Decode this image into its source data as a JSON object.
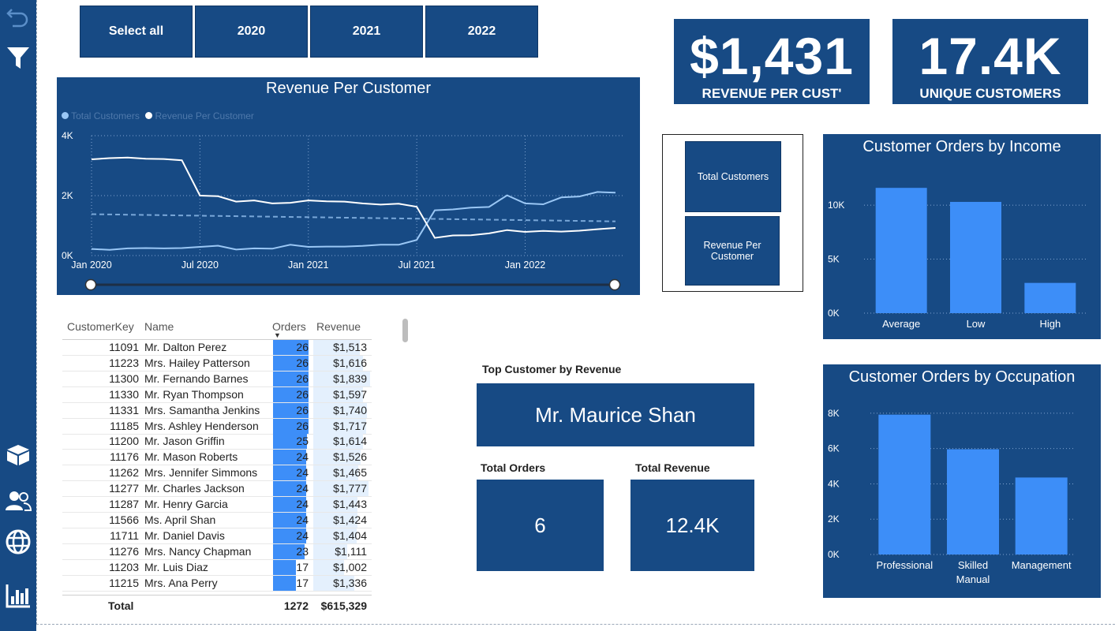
{
  "sidebar": {
    "icons": [
      "undo-icon",
      "filter-icon",
      "box-icon",
      "users-icon",
      "globe-icon",
      "bar-chart-icon"
    ]
  },
  "slicer": {
    "buttons": [
      "Select all",
      "2020",
      "2021",
      "2022"
    ]
  },
  "kpis": {
    "revenue_per_cust": {
      "value": "$1,431",
      "label": "REVENUE PER CUST'"
    },
    "unique_customers": {
      "value": "17.4K",
      "label": "UNIQUE CUSTOMERS"
    }
  },
  "toggle": {
    "buttons": [
      "Total Customers",
      "Revenue Per Customer"
    ]
  },
  "line_chart": {
    "title": "Revenue Per Customer",
    "legend": [
      "Total Customers",
      "Revenue Per Customer"
    ],
    "y_ticks": [
      "4K",
      "2K",
      "0K"
    ],
    "x_ticks": [
      "Jan 2020",
      "Jul 2020",
      "Jan 2021",
      "Jul 2021",
      "Jan 2022"
    ]
  },
  "table": {
    "headers": [
      "CustomerKey",
      "Name",
      "Orders",
      "Revenue"
    ],
    "rows": [
      [
        "11091",
        "Mr. Dalton Perez",
        "26",
        "$1,513"
      ],
      [
        "11223",
        "Mrs. Hailey Patterson",
        "26",
        "$1,616"
      ],
      [
        "11300",
        "Mr. Fernando Barnes",
        "26",
        "$1,839"
      ],
      [
        "11330",
        "Mr. Ryan Thompson",
        "26",
        "$1,597"
      ],
      [
        "11331",
        "Mrs. Samantha Jenkins",
        "26",
        "$1,740"
      ],
      [
        "11185",
        "Mrs. Ashley Henderson",
        "26",
        "$1,717"
      ],
      [
        "11200",
        "Mr. Jason Griffin",
        "25",
        "$1,614"
      ],
      [
        "11176",
        "Mr. Mason Roberts",
        "24",
        "$1,526"
      ],
      [
        "11262",
        "Mrs. Jennifer Simmons",
        "24",
        "$1,465"
      ],
      [
        "11277",
        "Mr. Charles Jackson",
        "24",
        "$1,777"
      ],
      [
        "11287",
        "Mr. Henry Garcia",
        "24",
        "$1,443"
      ],
      [
        "11566",
        "Ms. April Shan",
        "24",
        "$1,424"
      ],
      [
        "11711",
        "Mr. Daniel Davis",
        "24",
        "$1,404"
      ],
      [
        "11276",
        "Mrs. Nancy Chapman",
        "23",
        "$1,111"
      ],
      [
        "11203",
        "Mr. Luis Diaz",
        "17",
        "$1,002"
      ],
      [
        "11215",
        "Mrs. Ana Perry",
        "17",
        "$1,336"
      ]
    ],
    "total": {
      "label": "Total",
      "orders": "1272",
      "revenue": "$615,329"
    }
  },
  "top_customer": {
    "title": "Top Customer by Revenue",
    "name": "Mr. Maurice Shan",
    "orders_label": "Total Orders",
    "orders_value": "6",
    "revenue_label": "Total Revenue",
    "revenue_value": "12.4K"
  },
  "chart_data": [
    {
      "type": "line",
      "title": "Revenue Per Customer",
      "x": [
        "2020-01",
        "2020-02",
        "2020-03",
        "2020-04",
        "2020-05",
        "2020-06",
        "2020-07",
        "2020-08",
        "2020-09",
        "2020-10",
        "2020-11",
        "2020-12",
        "2021-01",
        "2021-02",
        "2021-03",
        "2021-04",
        "2021-05",
        "2021-06",
        "2021-07",
        "2021-08",
        "2021-09",
        "2021-10",
        "2021-11",
        "2021-12",
        "2022-01",
        "2022-02",
        "2022-03",
        "2022-04",
        "2022-05",
        "2022-06"
      ],
      "series": [
        {
          "name": "Total Customers",
          "values": [
            220,
            190,
            240,
            250,
            240,
            250,
            290,
            330,
            200,
            240,
            230,
            360,
            290,
            300,
            300,
            320,
            360,
            360,
            520,
            1510,
            1540,
            1600,
            1620,
            2010,
            1740,
            1710,
            1940,
            1970,
            2120,
            2100
          ]
        },
        {
          "name": "Revenue Per Customer",
          "values": [
            3210,
            3250,
            3270,
            3230,
            3220,
            3180,
            2000,
            1980,
            1800,
            1840,
            1740,
            1760,
            1840,
            1810,
            1800,
            1740,
            1700,
            1730,
            1630,
            590,
            670,
            680,
            740,
            850,
            790,
            820,
            800,
            830,
            880,
            920
          ]
        }
      ],
      "average_line": {
        "from": 1380,
        "to": 1140
      },
      "ylim": [
        0,
        4000
      ]
    },
    {
      "type": "bar",
      "title": "Customer Orders by Income",
      "categories": [
        "Average",
        "Low",
        "High"
      ],
      "values": [
        11600,
        10300,
        2800
      ],
      "y_ticks": [
        "10K",
        "5K",
        "0K"
      ],
      "ylim": [
        0,
        13000
      ],
      "color": "#3d8ef8"
    },
    {
      "type": "bar",
      "title": "Customer Orders by Occupation",
      "categories": [
        "Professional",
        "Skilled Manual",
        "Management"
      ],
      "values": [
        7920,
        5960,
        4360
      ],
      "y_ticks": [
        "8K",
        "6K",
        "4K",
        "2K",
        "0K"
      ],
      "ylim": [
        0,
        8800
      ],
      "color": "#3d8ef8"
    }
  ],
  "colors": {
    "navy": "#174a84",
    "bar_blue": "#3d8ef8",
    "light_line": "#9ac7f5"
  }
}
